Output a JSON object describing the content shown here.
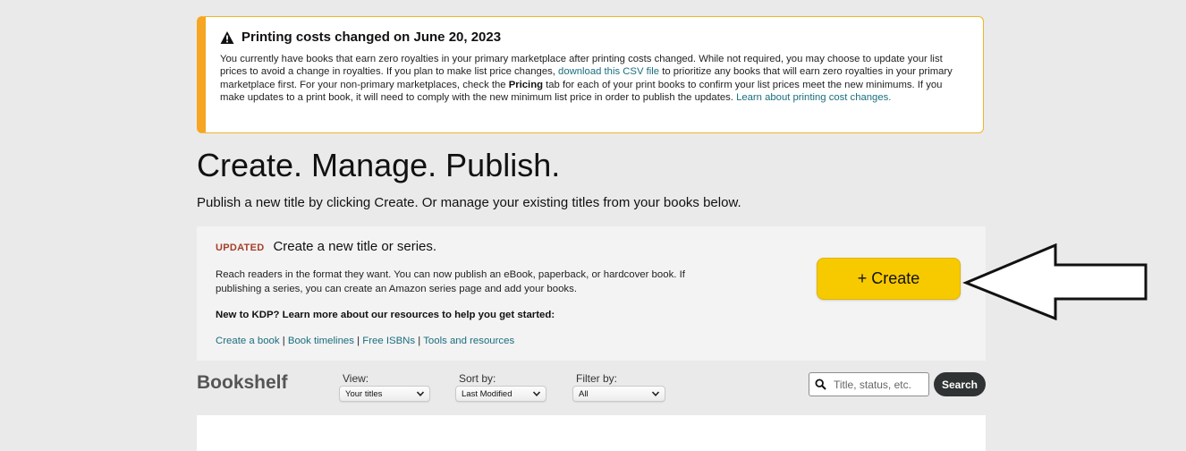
{
  "alert": {
    "title": "Printing costs changed on June 20, 2023",
    "body_part1": "You currently have books that earn zero royalties in your primary marketplace after printing costs changed. While not required, you may choose to update your list prices to avoid a change in royalties. If you plan to make list price changes, ",
    "csv_link": "download this CSV file",
    "body_part2": " to prioritize any books that will earn zero royalties in your primary marketplace first. For your non-primary marketplaces, check the ",
    "pricing_bold": "Pricing",
    "body_part3": " tab for each of your print books to confirm your list prices meet the new minimums. If you make updates to a print book, it will need to comply with the new minimum list price in order to publish the updates. ",
    "learn_link": "Learn about printing cost changes."
  },
  "hero": {
    "title": "Create. Manage. Publish.",
    "subtitle": "Publish a new title by clicking Create. Or manage your existing titles from your books below."
  },
  "create_panel": {
    "badge": "UPDATED",
    "title": "Create a new title or series.",
    "description": "Reach readers in the format they want. You can now publish an eBook, paperback, or hardcover book. If publishing a series, you can create an Amazon series page and add your books.",
    "learn_more": "New to KDP? Learn more about our resources to help you get started:",
    "links": [
      "Create a book",
      "Book timelines",
      "Free ISBNs",
      "Tools and resources"
    ],
    "separator": " | ",
    "create_button": "+ Create"
  },
  "bookshelf": {
    "label": "Bookshelf",
    "view": {
      "label": "View:",
      "value": "Your titles"
    },
    "sort": {
      "label": "Sort by:",
      "value": "Last Modified"
    },
    "filter": {
      "label": "Filter by:",
      "value": "All"
    },
    "search_placeholder": "Title, status, etc.",
    "search_button": "Search"
  },
  "colors": {
    "create_button": "#f7ca00",
    "alert_accent": "#f6a623",
    "link": "#1a6e7e",
    "badge": "#a63d2a"
  }
}
